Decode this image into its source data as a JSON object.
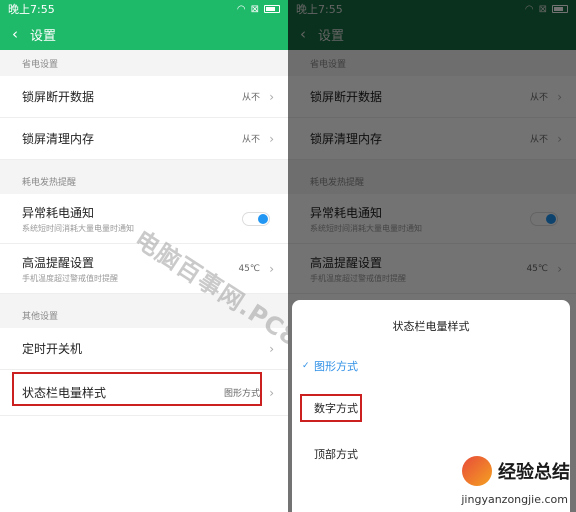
{
  "status": {
    "time": "晚上7:55"
  },
  "appbar": {
    "title": "设置"
  },
  "sections": {
    "power_saving": "省电设置",
    "heat": "耗电发热提醒",
    "other": "其他设置"
  },
  "rows": {
    "lock_data": {
      "title": "锁屏断开数据",
      "value": "从不"
    },
    "lock_mem": {
      "title": "锁屏清理内存",
      "value": "从不"
    },
    "abnormal": {
      "title": "异常耗电通知",
      "sub": "系统短时间消耗大量电量时通知",
      "enabled": true
    },
    "hightemp": {
      "title": "高温提醒设置",
      "sub": "手机温度超过警戒值时提醒",
      "value": "45℃"
    },
    "timer": {
      "title": "定时开关机"
    },
    "battery_style": {
      "title": "状态栏电量样式",
      "value": "图形方式"
    }
  },
  "dialog": {
    "title": "状态栏电量样式",
    "options": [
      {
        "label": "图形方式",
        "selected": true
      },
      {
        "label": "数字方式",
        "selected": false
      },
      {
        "label": "顶部方式",
        "selected": false
      }
    ]
  },
  "watermark": "电脑百事网.PC841.COM",
  "site": {
    "name": "经验总结",
    "url": "jingyanzongjie.com"
  },
  "colors": {
    "accent": "#1fb96a",
    "toggle": "#2196f3",
    "highlight": "#cc2020"
  }
}
